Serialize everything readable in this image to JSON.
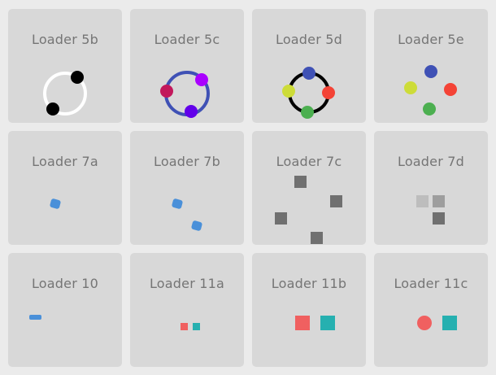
{
  "loaders": [
    {
      "id": "5b",
      "title": "Loader 5b"
    },
    {
      "id": "5c",
      "title": "Loader 5c"
    },
    {
      "id": "5d",
      "title": "Loader 5d"
    },
    {
      "id": "5e",
      "title": "Loader 5e"
    },
    {
      "id": "7a",
      "title": "Loader 7a"
    },
    {
      "id": "7b",
      "title": "Loader 7b"
    },
    {
      "id": "7c",
      "title": "Loader 7c"
    },
    {
      "id": "7d",
      "title": "Loader 7d"
    },
    {
      "id": "10",
      "title": "Loader 10"
    },
    {
      "id": "11a",
      "title": "Loader 11a"
    },
    {
      "id": "11b",
      "title": "Loader 11b"
    },
    {
      "id": "11c",
      "title": "Loader 11c"
    }
  ],
  "colors": {
    "page_background": "#ebebeb",
    "tile_background": "#d8d8d8",
    "title_text": "#757575",
    "black": "#000000",
    "white": "#ffffff",
    "indigo": "#3f51b5",
    "magenta": "#c2185b",
    "violet": "#aa00ff",
    "purple": "#6200ea",
    "blue_dot": "#3f51b5",
    "red_dot": "#f44336",
    "green_dot": "#4caf50",
    "yellow_dot": "#cddc39",
    "sky_blue": "#4a90d9",
    "dark_gray": "#707070",
    "light_gray": "#bdbdbd",
    "mid_gray": "#9e9e9e",
    "coral": "#f06060",
    "teal": "#26b0b0"
  }
}
